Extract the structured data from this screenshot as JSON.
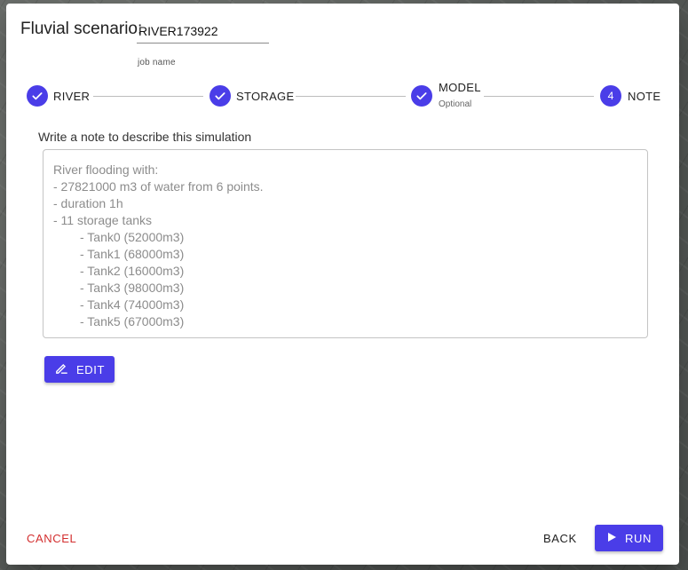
{
  "dialog": {
    "title": "Fluvial scenario:",
    "job_name": {
      "value": "RIVER173922",
      "helper": "job name"
    }
  },
  "stepper": {
    "steps": [
      {
        "label": "RIVER",
        "state": "completed",
        "icon": "check-icon"
      },
      {
        "label": "STORAGE",
        "state": "completed",
        "icon": "check-icon"
      },
      {
        "label": "MODEL",
        "optional_label": "Optional",
        "state": "completed",
        "icon": "check-icon"
      },
      {
        "label": "NOTE",
        "number": "4",
        "state": "active"
      }
    ]
  },
  "note": {
    "caption": "Write a note to describe this simulation",
    "lines": [
      "River flooding with:",
      "- 27821000 m3 of water from 6 points.",
      "- duration 1h",
      "- 11 storage tanks",
      "- Tank0 (52000m3)",
      "- Tank1 (68000m3)",
      "- Tank2 (16000m3)",
      "- Tank3 (98000m3)",
      "- Tank4 (74000m3)",
      "- Tank5 (67000m3)"
    ]
  },
  "actions": {
    "edit_label": "EDIT",
    "cancel_label": "CANCEL",
    "back_label": "BACK",
    "run_label": "RUN"
  },
  "colors": {
    "primary": "#4a3de8",
    "cancel": "#d32f2f"
  }
}
